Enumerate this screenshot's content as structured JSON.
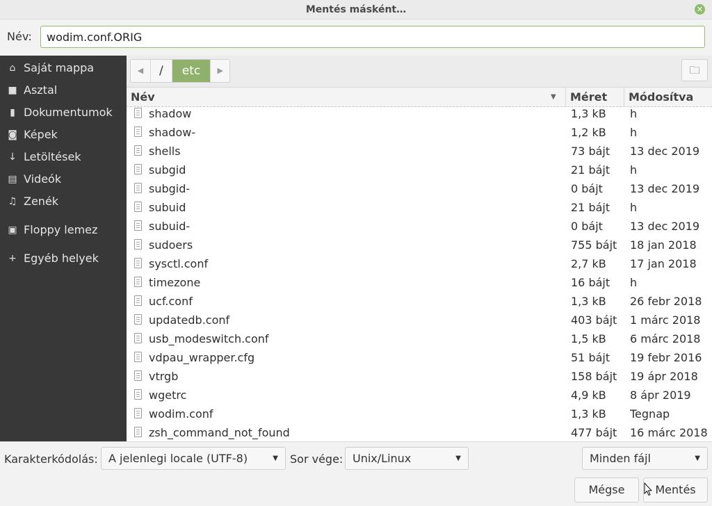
{
  "window": {
    "title": "Mentés másként…"
  },
  "name_field": {
    "label": "Név:",
    "value": "wodim.conf.ORIG"
  },
  "sidebar": {
    "items": [
      {
        "icon": "home-icon",
        "label": "Saját mappa"
      },
      {
        "icon": "desktop-icon",
        "label": "Asztal"
      },
      {
        "icon": "document-icon",
        "label": "Dokumentumok"
      },
      {
        "icon": "camera-icon",
        "label": "Képek"
      },
      {
        "icon": "download-icon",
        "label": "Letöltések"
      },
      {
        "icon": "film-icon",
        "label": "Videók"
      },
      {
        "icon": "music-icon",
        "label": "Zenék"
      },
      {
        "icon": "floppy-icon",
        "label": "Floppy lemez"
      },
      {
        "icon": "plus-icon",
        "label": "Egyéb helyek"
      }
    ]
  },
  "pathbar": {
    "segments": [
      "/",
      "etc"
    ],
    "active": "etc"
  },
  "columns": {
    "name": "Név",
    "size": "Méret",
    "modified": "Módosítva"
  },
  "files": [
    {
      "name": "shadow",
      "size": "1,3 kB",
      "modified": "h"
    },
    {
      "name": "shadow-",
      "size": "1,2 kB",
      "modified": "h"
    },
    {
      "name": "shells",
      "size": "73 bájt",
      "modified": "13 dec 2019"
    },
    {
      "name": "subgid",
      "size": "21 bájt",
      "modified": "h"
    },
    {
      "name": "subgid-",
      "size": "0 bájt",
      "modified": "13 dec 2019"
    },
    {
      "name": "subuid",
      "size": "21 bájt",
      "modified": "h"
    },
    {
      "name": "subuid-",
      "size": "0 bájt",
      "modified": "13 dec 2019"
    },
    {
      "name": "sudoers",
      "size": "755 bájt",
      "modified": "18 jan 2018"
    },
    {
      "name": "sysctl.conf",
      "size": "2,7 kB",
      "modified": "17 jan 2018"
    },
    {
      "name": "timezone",
      "size": "16 bájt",
      "modified": "h"
    },
    {
      "name": "ucf.conf",
      "size": "1,3 kB",
      "modified": "26 febr 2018"
    },
    {
      "name": "updatedb.conf",
      "size": "403 bájt",
      "modified": "1 márc 2018"
    },
    {
      "name": "usb_modeswitch.conf",
      "size": "1,5 kB",
      "modified": "6 márc 2018"
    },
    {
      "name": "vdpau_wrapper.cfg",
      "size": "51 bájt",
      "modified": "19 febr 2016"
    },
    {
      "name": "vtrgb",
      "size": "158 bájt",
      "modified": "19 ápr 2018"
    },
    {
      "name": "wgetrc",
      "size": "4,9 kB",
      "modified": "8 ápr 2019"
    },
    {
      "name": "wodim.conf",
      "size": "1,3 kB",
      "modified": "Tegnap"
    },
    {
      "name": "zsh_command_not_found",
      "size": "477 bájt",
      "modified": "16 márc 2018"
    }
  ],
  "encoding": {
    "label": "Karakterkódolás:",
    "value": "A jelenlegi locale (UTF-8)"
  },
  "line_end": {
    "label": "Sor vége:",
    "value": "Unix/Linux"
  },
  "filter": {
    "value": "Minden fájl"
  },
  "buttons": {
    "cancel": "Mégse",
    "save": "Mentés"
  },
  "colors": {
    "accent": "#8fb16b",
    "sidebar_bg": "#383838"
  }
}
